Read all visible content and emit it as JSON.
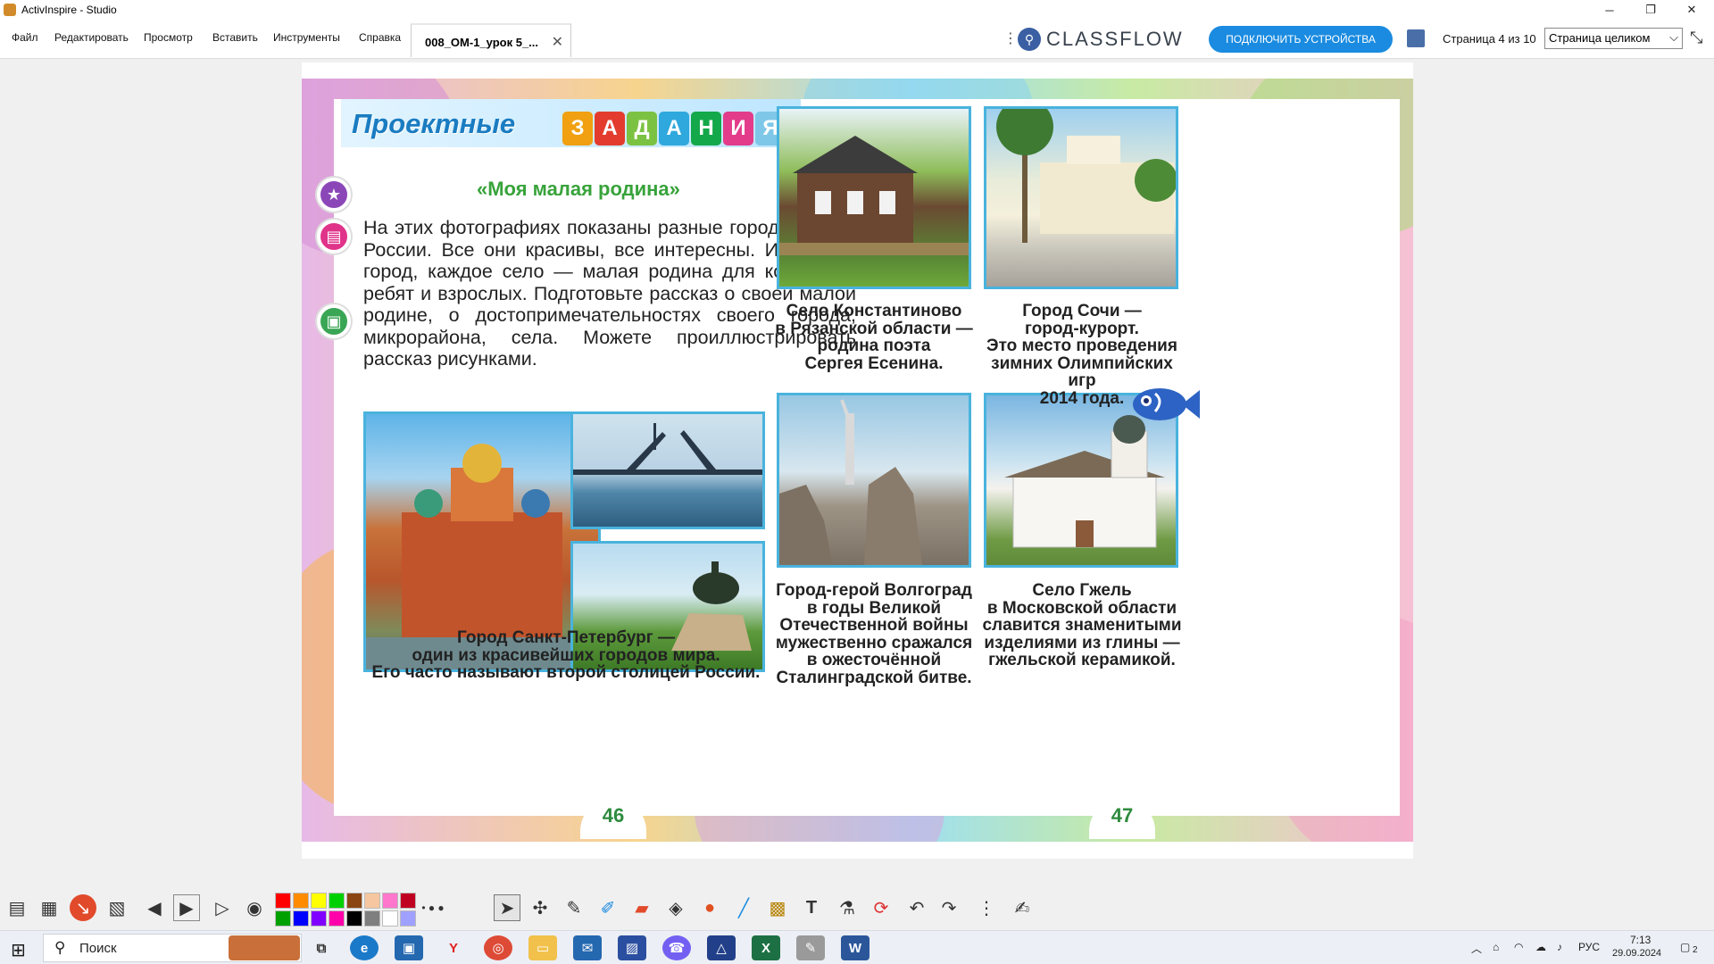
{
  "window": {
    "title": "ActivInspire - Studio",
    "minimize": "─",
    "restore": "❐",
    "close": "✕"
  },
  "menu": {
    "items": [
      "Файл",
      "Редактировать",
      "Просмотр",
      "Вставить",
      "Инструменты",
      "Справка"
    ]
  },
  "doc_tab": {
    "label": "008_ОМ-1_урок 5_...",
    "close": "✕"
  },
  "kebab": "⋮",
  "classflow": {
    "logo": "CLASSFLOW",
    "connect_button": "ПОДКЛЮЧИТЬ УСТРОЙСТВА"
  },
  "page_indicator": "Страница 4 из 10",
  "zoom": {
    "selected": "Страница целиком"
  },
  "book": {
    "heading_word": "Проектные",
    "heading_letters": [
      "З",
      "А",
      "Д",
      "А",
      "Н",
      "И",
      "Я"
    ],
    "task_title": "«Моя малая родина»",
    "task_text": "    На этих фотографиях показаны разные города и сёла России. Все они красивы, все интересны. И каждый город, каждое село — малая родина для кого-то из ребят и взрослых.     Подготовьте рассказ о своей малой родине, о достопримечательностях своего города, микрорайона, села. Можете проиллюстрировать рассказ рисунками.",
    "captions": {
      "konstantinovo": "Село Константиново\nв Рязанской области —\nродина поэта\nСергея Есенина.",
      "sochi": "Город Сочи —\nгород-курорт.\nЭто место проведения\nзимних Олимпийских игр\n2014 года.",
      "spb": "Город Санкт-Петербург —\nодин из красивейших городов мира.\nЕго часто называют второй столицей России.",
      "volgograd": "Город-герой Волгоград\nв годы Великой\nОтечественной войны\nмужественно сражался\nв ожесточённой\nСталинградской битве.",
      "gzhel": "Село Гжель\nв Московской области\nславится знаменитыми\nизделиями из глины —\nгжельской керамикой."
    },
    "page_left": "46",
    "page_right": "47"
  },
  "palette": [
    "#ff0000",
    "#ff8c00",
    "#ffff00",
    "#00d000",
    "#8b4513",
    "#f5c6a0",
    "#ff77cc",
    "#c00020",
    "#00a000",
    "#0000ff",
    "#8000ff",
    "#ff00aa",
    "#000000",
    "#7f7f7f",
    "#ffffff",
    "#a0a0ff"
  ],
  "taskbar": {
    "search_placeholder": "Поиск",
    "tray": {
      "lang": "РУС",
      "time": "7:13",
      "date": "29.09.2024",
      "notifications": "2"
    }
  }
}
